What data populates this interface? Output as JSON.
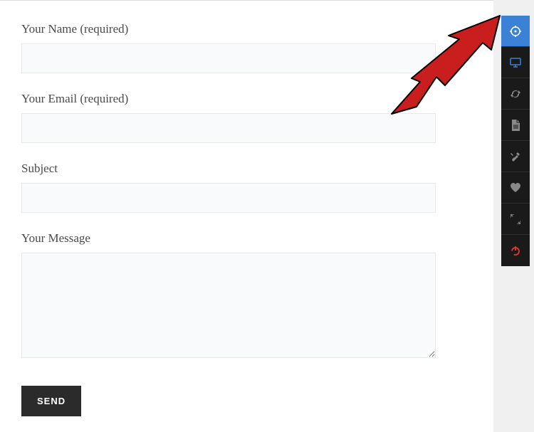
{
  "form": {
    "name_label": "Your Name (required)",
    "email_label": "Your Email (required)",
    "subject_label": "Subject",
    "message_label": "Your Message",
    "name_value": "",
    "email_value": "",
    "subject_value": "",
    "message_value": "",
    "send_label": "SEND"
  },
  "toolbar": {
    "items": [
      {
        "name": "target-icon",
        "active": true
      },
      {
        "name": "monitor-icon",
        "active": false
      },
      {
        "name": "sync-icon",
        "active": false
      },
      {
        "name": "file-icon",
        "active": false
      },
      {
        "name": "tools-icon",
        "active": false
      },
      {
        "name": "heart-icon",
        "active": false
      },
      {
        "name": "expand-icon",
        "active": false
      },
      {
        "name": "power-icon",
        "active": false
      }
    ]
  },
  "colors": {
    "accent": "#3b82d6",
    "danger": "#e63a2e",
    "dark": "#1a1a1a",
    "arrow": "#c81e1e"
  }
}
